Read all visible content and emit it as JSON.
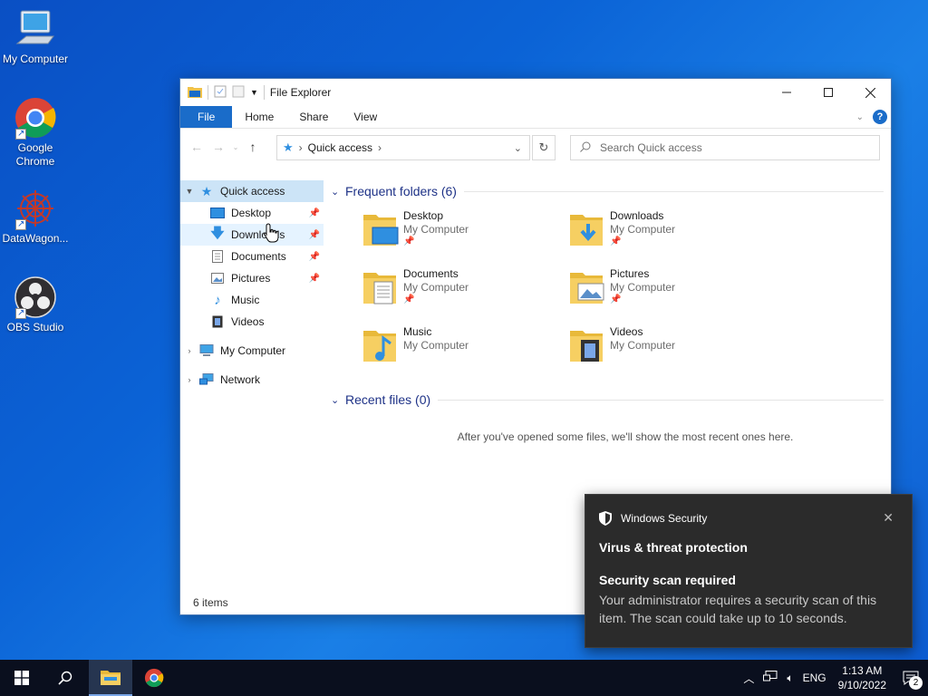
{
  "desktop": {
    "icons": [
      {
        "label": "My Computer"
      },
      {
        "label": "Google Chrome"
      },
      {
        "label": "DataWagon..."
      },
      {
        "label": "OBS Studio"
      }
    ]
  },
  "window": {
    "title": "File Explorer",
    "ribbon_tabs": [
      "File",
      "Home",
      "Share",
      "View"
    ],
    "address_path": "Quick access",
    "search_placeholder": "Search Quick access",
    "nav": {
      "quick_access": "Quick access",
      "items": [
        "Desktop",
        "Downloads",
        "Documents",
        "Pictures",
        "Music",
        "Videos"
      ],
      "my_computer": "My Computer",
      "network": "Network"
    },
    "frequent_header": "Frequent folders (6)",
    "folders": [
      {
        "name": "Desktop",
        "location": "My Computer",
        "pinned": true
      },
      {
        "name": "Downloads",
        "location": "My Computer",
        "pinned": true
      },
      {
        "name": "Documents",
        "location": "My Computer",
        "pinned": true
      },
      {
        "name": "Pictures",
        "location": "My Computer",
        "pinned": true
      },
      {
        "name": "Music",
        "location": "My Computer",
        "pinned": false
      },
      {
        "name": "Videos",
        "location": "My Computer",
        "pinned": false
      }
    ],
    "recent_header": "Recent files (0)",
    "recent_message": "After you've opened some files, we'll show the most recent ones here.",
    "status": "6 items"
  },
  "toast": {
    "source": "Windows Security",
    "app_title": "Virus & threat protection",
    "title": "Security scan required",
    "body": "Your administrator requires a security scan of this item. The scan could take up to 10 seconds."
  },
  "taskbar": {
    "language": "ENG",
    "time": "1:13 AM",
    "date": "9/10/2022",
    "notification_count": "2"
  },
  "colors": {
    "accent": "#1a6cc9",
    "header_text": "#1e3287",
    "toast_bg": "#2b2b2b",
    "taskbar_bg": "#0a0f1e"
  }
}
